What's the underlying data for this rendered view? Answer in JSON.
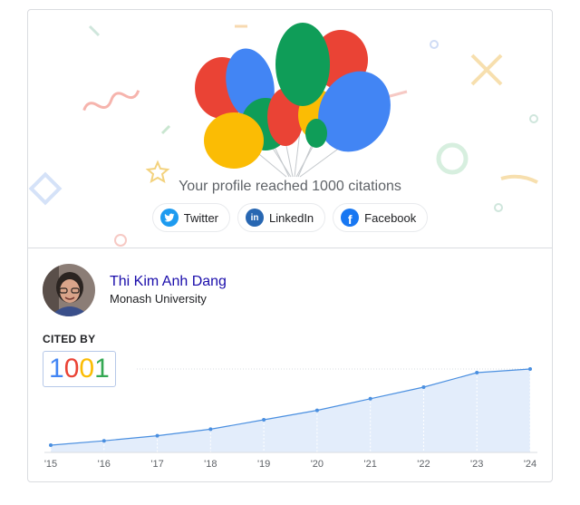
{
  "celebration": {
    "message": "Your profile reached 1000 citations",
    "share": [
      {
        "label": "Twitter",
        "icon": "twitter-icon",
        "color": "#1d9bf0"
      },
      {
        "label": "LinkedIn",
        "icon": "linkedin-icon",
        "color": "#2867b2"
      },
      {
        "label": "Facebook",
        "icon": "facebook-icon",
        "color": "#1877f2"
      }
    ],
    "balloon_colors": [
      "#ea4335",
      "#4285f4",
      "#0f9d58",
      "#fbbc04"
    ]
  },
  "profile": {
    "name": "Thi Kim Anh Dang",
    "affiliation": "Monash University"
  },
  "cited_by": {
    "heading": "CITED BY",
    "digits": [
      "1",
      "0",
      "0",
      "1"
    ],
    "digit_colors": [
      "#4285f4",
      "#ea4335",
      "#fbbc04",
      "#34a853"
    ]
  },
  "chart_data": {
    "type": "area",
    "x": [
      "'15",
      "'16",
      "'17",
      "'18",
      "'19",
      "'20",
      "'21",
      "'22",
      "'23",
      "'24"
    ],
    "values": [
      10,
      16,
      23,
      32,
      45,
      58,
      74,
      90,
      110,
      115
    ],
    "ylim": [
      0,
      120
    ],
    "line_color": "#4a8fe0",
    "fill_color": "#e3edfb",
    "grid": "vertical"
  }
}
